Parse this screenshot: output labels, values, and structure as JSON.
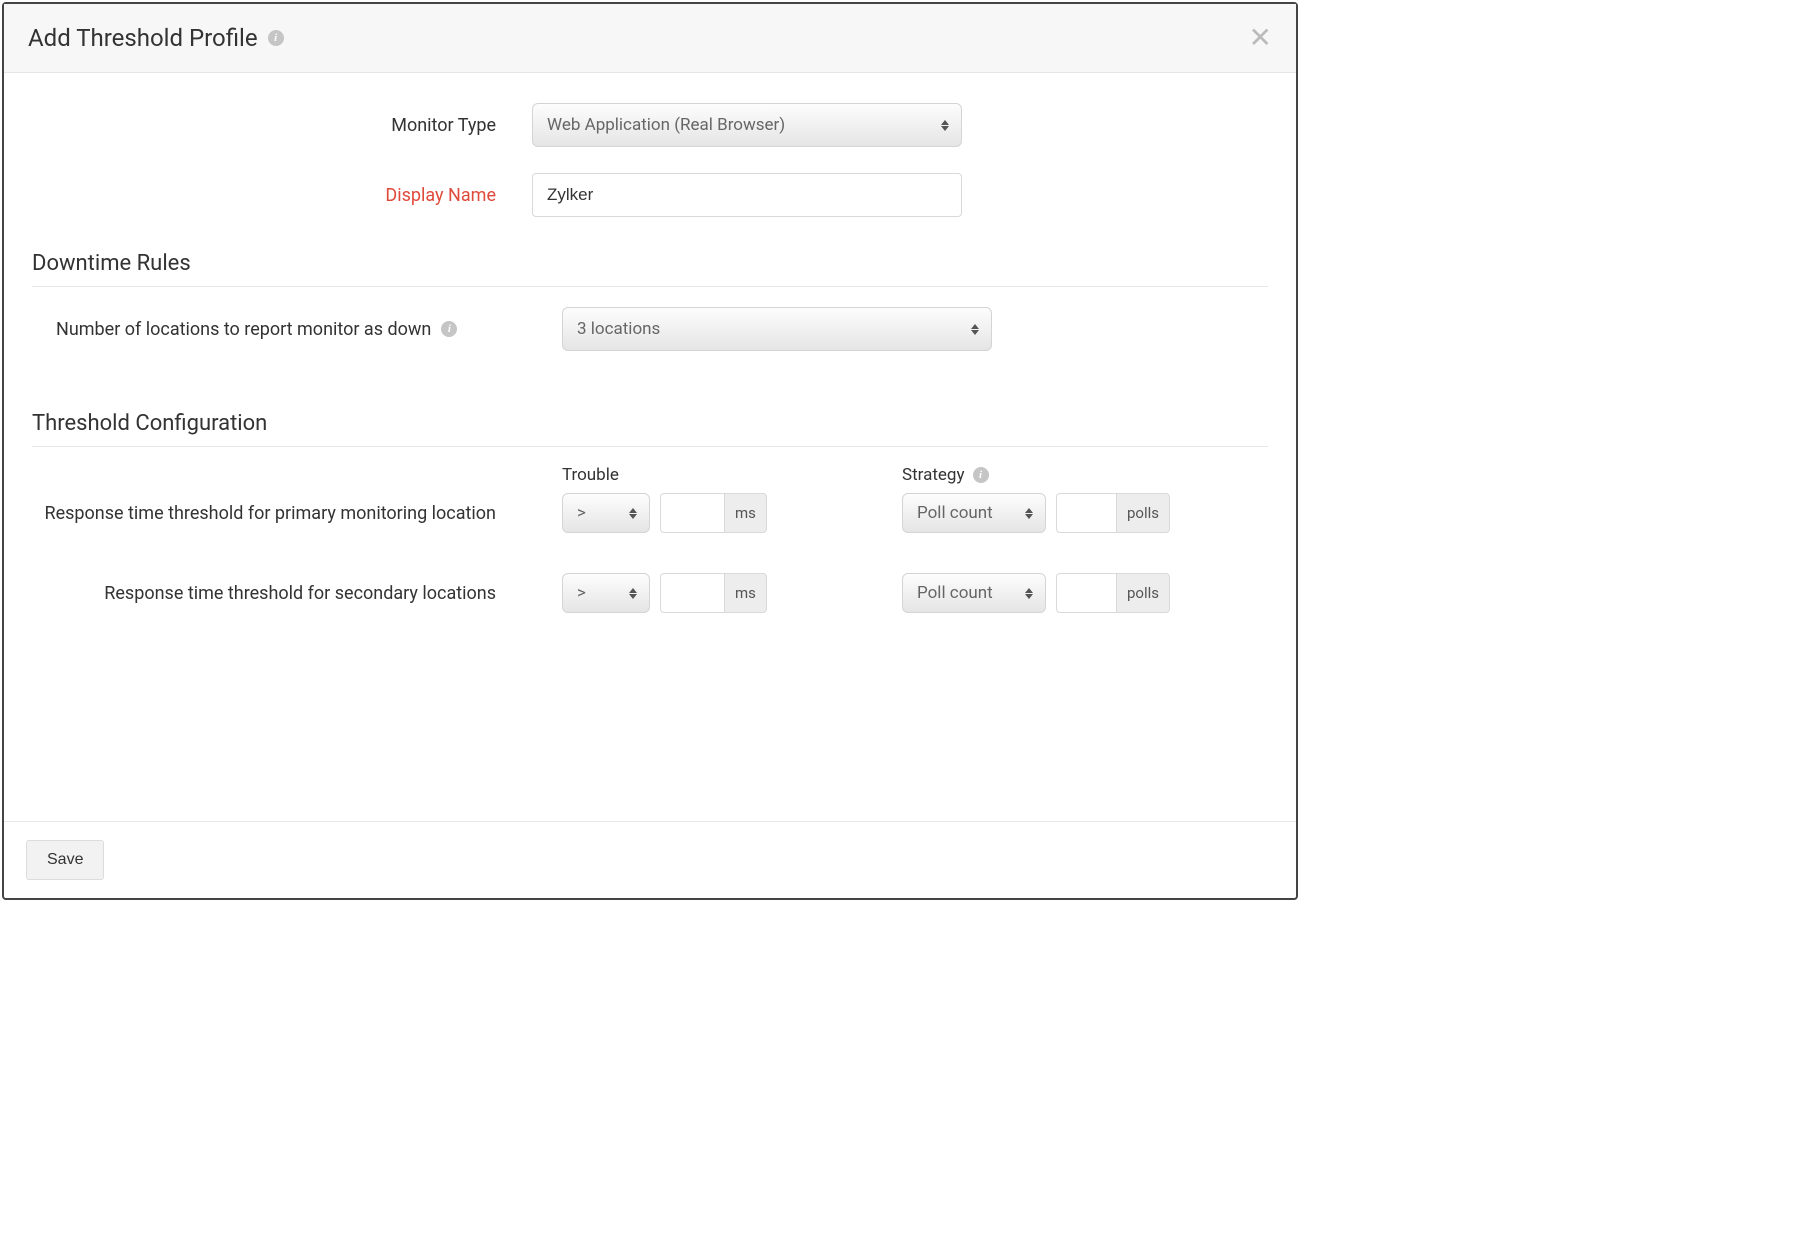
{
  "header": {
    "title": "Add Threshold Profile"
  },
  "monitor_type": {
    "label": "Monitor Type",
    "value": "Web Application (Real Browser)"
  },
  "display_name": {
    "label": "Display Name",
    "value": "Zylker"
  },
  "downtime": {
    "heading": "Downtime Rules",
    "locations_label": "Number of locations to report monitor as down",
    "locations_value": "3 locations"
  },
  "threshold": {
    "heading": "Threshold Configuration",
    "col_trouble": "Trouble",
    "col_strategy": "Strategy",
    "primary_label": "Response time threshold for primary monitoring location",
    "secondary_label": "Response time threshold for secondary locations",
    "operator": ">",
    "unit_ms": "ms",
    "strategy_value": "Poll count",
    "unit_polls": "polls"
  },
  "footer": {
    "save": "Save"
  }
}
